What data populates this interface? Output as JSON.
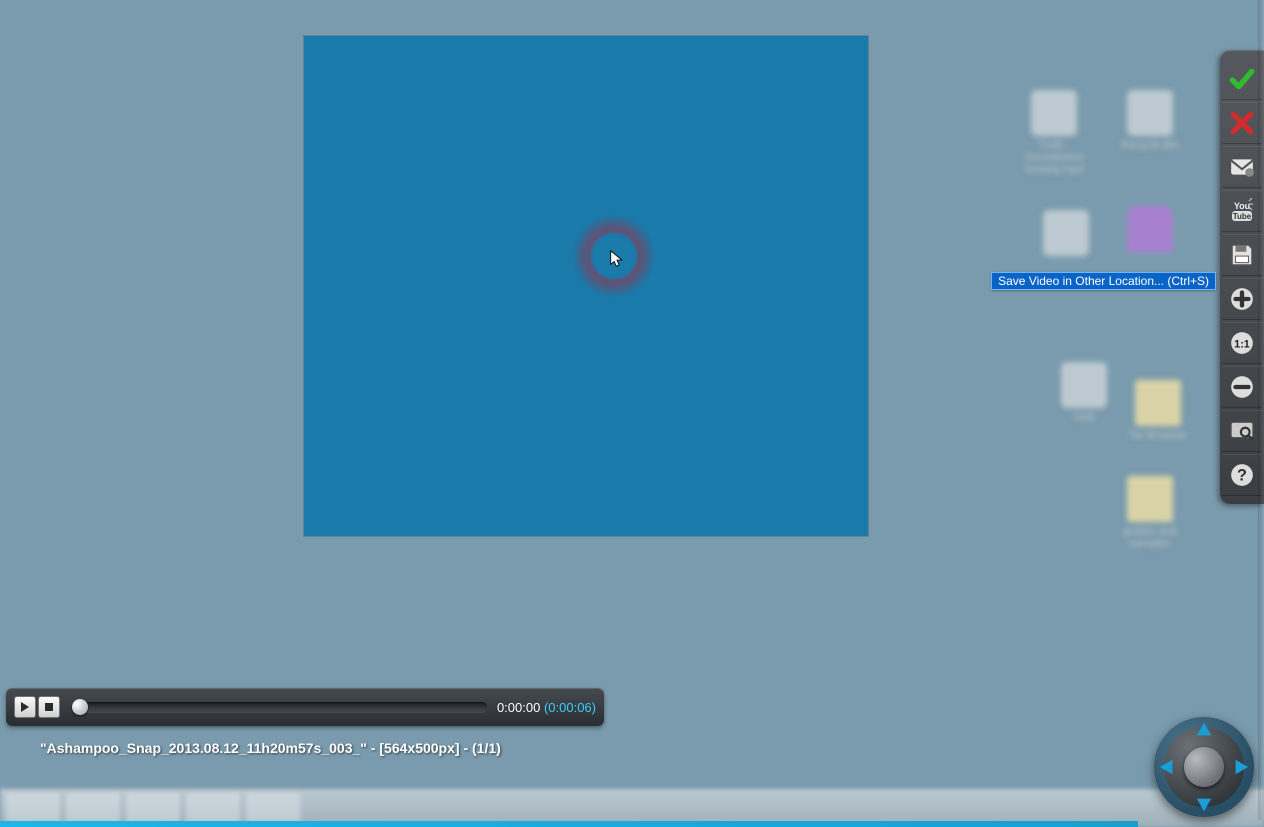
{
  "capture": {
    "filename": "\"Ashampoo_Snap_2013.08.12_11h20m57s_003_\"",
    "dimensions": "[564x500px]",
    "index": "(1/1)"
  },
  "playback": {
    "current_time": "0:00:00",
    "duration": "(0:00:06)"
  },
  "tooltip": {
    "save_video": "Save Video in Other Location... (Ctrl+S)"
  },
  "toolbar": {
    "accept": "Accept",
    "discard": "Discard",
    "email": "Send by Email",
    "youtube": "Upload to YouTube",
    "save": "Save Video in Other Location",
    "zoom_in": "Zoom In",
    "zoom_11": "1:1",
    "zoom_out": "Zoom Out",
    "fullscreen": "View Fullscreen",
    "help": "Help"
  },
  "desktop_icons": {
    "item1": "Truth - Surveillance Society.mp3",
    "item2": "Recycle Bin",
    "item3": "mob",
    "item4": "Tor Browser",
    "item5": "guides and samples"
  }
}
